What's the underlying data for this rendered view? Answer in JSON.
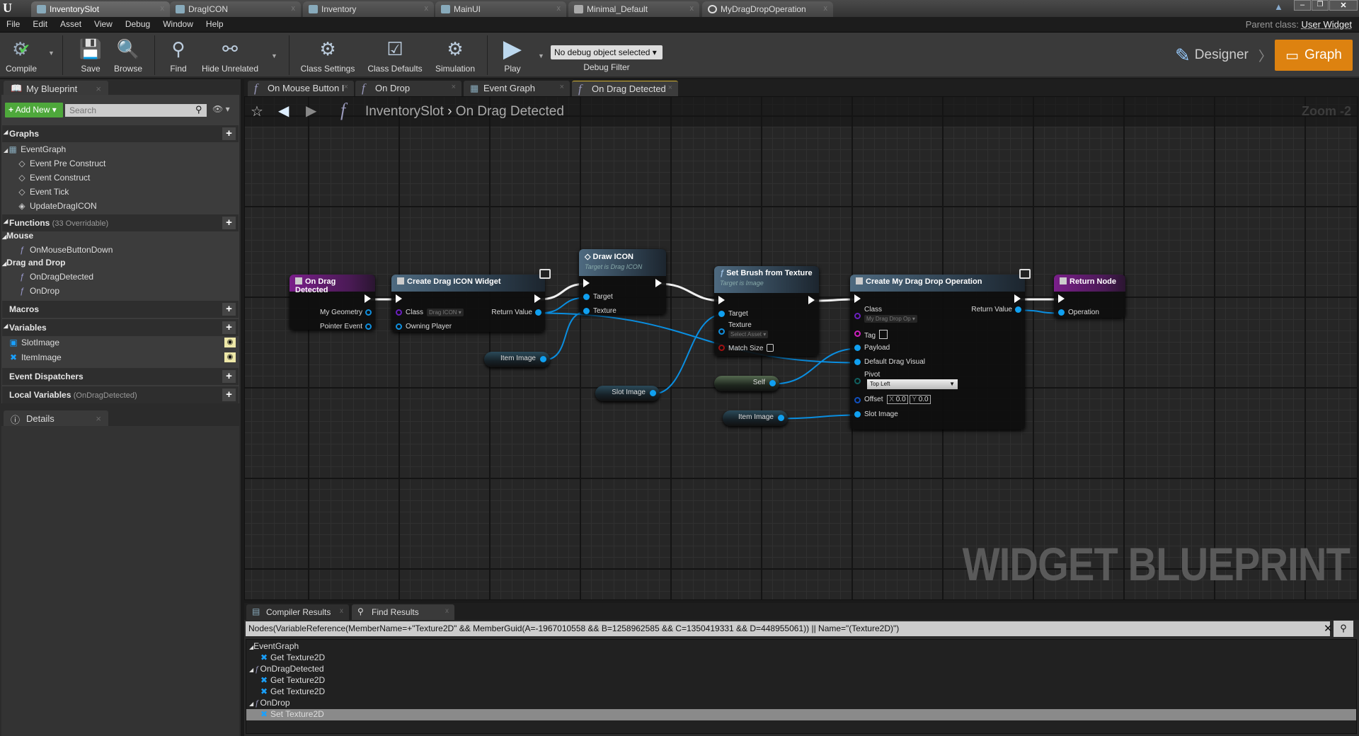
{
  "window": {
    "tabs": [
      "InventorySlot",
      "DragICON",
      "Inventory",
      "MainUI",
      "Minimal_Default",
      "MyDragDropOperation"
    ],
    "active_tab": 0,
    "parent_class_label": "Parent class:",
    "parent_class_value": "User Widget"
  },
  "menu": [
    "File",
    "Edit",
    "Asset",
    "View",
    "Debug",
    "Window",
    "Help"
  ],
  "toolbar": {
    "buttons": [
      {
        "label": "Compile",
        "icon": "compile-gears-check-icon"
      },
      {
        "label": "Save",
        "icon": "floppy-disk-icon"
      },
      {
        "label": "Browse",
        "icon": "magnifier-icon"
      },
      {
        "label": "Find",
        "icon": "binoculars-icon"
      },
      {
        "label": "Hide Unrelated",
        "icon": "node-graph-icon"
      },
      {
        "label": "Class Settings",
        "icon": "gear-document-icon"
      },
      {
        "label": "Class Defaults",
        "icon": "checklist-icon"
      },
      {
        "label": "Simulation",
        "icon": "gear-play-icon"
      },
      {
        "label": "Play",
        "icon": "play-icon"
      }
    ],
    "debug_object": "No debug object selected",
    "debug_filter_label": "Debug Filter",
    "designer_label": "Designer",
    "graph_label": "Graph",
    "accent": "#dd8210"
  },
  "my_blueprint": {
    "tab_label": "My Blueprint",
    "add_new": "Add New",
    "search_placeholder": "Search",
    "graphs": {
      "label": "Graphs",
      "event_graph": "EventGraph",
      "events": [
        "Event Pre Construct",
        "Event Construct",
        "Event Tick",
        "UpdateDragICON"
      ]
    },
    "functions": {
      "label": "Functions",
      "overridable": "(33 Overridable)",
      "categories": [
        {
          "name": "Mouse",
          "items": [
            "OnMouseButtonDown"
          ]
        },
        {
          "name": "Drag and Drop",
          "items": [
            "OnDragDetected",
            "OnDrop"
          ]
        }
      ]
    },
    "macros": "Macros",
    "variables": {
      "label": "Variables",
      "items": [
        "SlotImage",
        "ItemImage"
      ]
    },
    "event_dispatchers": "Event Dispatchers",
    "local_variables": {
      "label": "Local Variables",
      "context": "(OnDragDetected)"
    }
  },
  "details": {
    "tab_label": "Details"
  },
  "graph": {
    "tabs": [
      "On Mouse Button I",
      "On Drop",
      "Event Graph",
      "On Drag Detected"
    ],
    "active_tab": 3,
    "breadcrumb": {
      "root": "InventorySlot",
      "current": "On Drag Detected"
    },
    "zoom": "Zoom -2",
    "watermark": "WIDGET BLUEPRINT",
    "nodes": {
      "on_drag_detected": {
        "title": "On Drag Detected",
        "pins": [
          "My Geometry",
          "Pointer Event"
        ]
      },
      "create_drag_icon": {
        "title": "Create Drag ICON Widget",
        "class_label": "Class",
        "class_value": "Drag ICON",
        "owning_player": "Owning Player",
        "return_value": "Return Value"
      },
      "draw_icon": {
        "title": "Draw ICON",
        "subtitle": "Target is Drag ICON",
        "pins": [
          "Target",
          "Texture"
        ]
      },
      "set_brush": {
        "title": "Set Brush from Texture",
        "subtitle": "Target is Image",
        "target": "Target",
        "texture": "Texture",
        "texture_value": "Select Asset",
        "match_size": "Match Size"
      },
      "create_op": {
        "title": "Create My Drag Drop Operation",
        "class_label": "Class",
        "class_value": "My Drag Drop Op",
        "return_value": "Return Value",
        "tag": "Tag",
        "payload": "Payload",
        "default_drag_visual": "Default Drag Visual",
        "pivot": "Pivot",
        "pivot_value": "Top Left",
        "offset": "Offset",
        "offset_x": "0.0",
        "offset_y": "0.0",
        "x": "X",
        "y": "Y",
        "slot_image": "Slot Image"
      },
      "return_node": {
        "title": "Return Node",
        "operation": "Operation"
      },
      "item_image_1": "Item Image",
      "slot_image": "Slot Image",
      "self": "Self",
      "item_image_2": "Item Image"
    }
  },
  "bottom": {
    "tabs": [
      "Compiler Results",
      "Find Results"
    ],
    "active_tab": 1,
    "query": "Nodes(VariableReference(MemberName=+\"Texture2D\" && MemberGuid(A=-1967010558 && B=1258962585 && C=1350419331 && D=448955061)) || Name=\"(Texture2D)\")",
    "results": [
      {
        "text": "EventGraph",
        "level": 0,
        "kind": "graph"
      },
      {
        "text": "Get Texture2D",
        "level": 1,
        "kind": "var"
      },
      {
        "text": "OnDragDetected",
        "level": 0,
        "kind": "function"
      },
      {
        "text": "Get Texture2D",
        "level": 1,
        "kind": "var"
      },
      {
        "text": "Get Texture2D",
        "level": 1,
        "kind": "var"
      },
      {
        "text": "OnDrop",
        "level": 0,
        "kind": "function"
      },
      {
        "text": "Set Texture2D",
        "level": 1,
        "kind": "var",
        "selected": true
      }
    ]
  }
}
